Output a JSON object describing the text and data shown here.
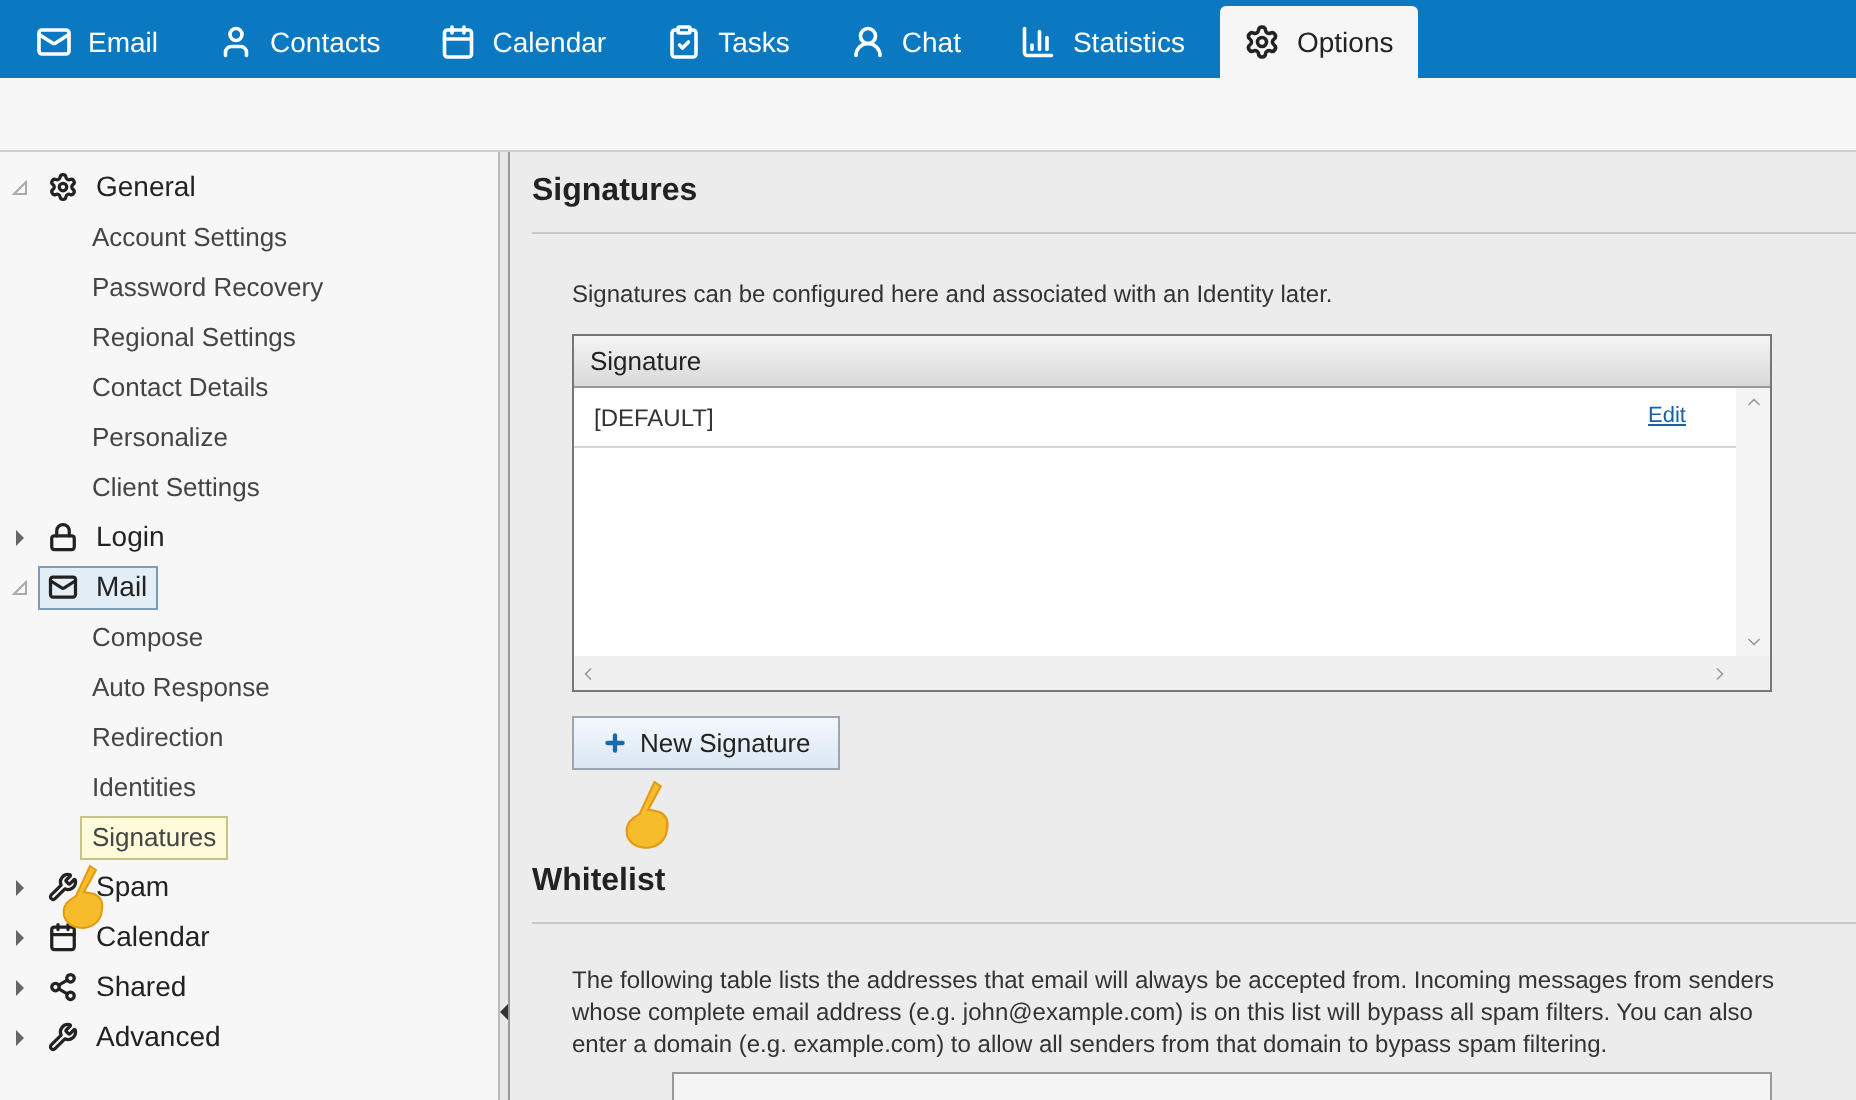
{
  "tabs": [
    {
      "label": "Email",
      "selected": false
    },
    {
      "label": "Contacts",
      "selected": false
    },
    {
      "label": "Calendar",
      "selected": false
    },
    {
      "label": "Tasks",
      "selected": false
    },
    {
      "label": "Chat",
      "selected": false
    },
    {
      "label": "Statistics",
      "selected": false
    },
    {
      "label": "Options",
      "selected": true
    }
  ],
  "sidebar": {
    "items": [
      {
        "label": "General",
        "expanded": true,
        "selected": false,
        "children": [
          {
            "label": "Account Settings",
            "selected": false
          },
          {
            "label": "Password Recovery",
            "selected": false
          },
          {
            "label": "Regional Settings",
            "selected": false
          },
          {
            "label": "Contact Details",
            "selected": false
          },
          {
            "label": "Personalize",
            "selected": false
          },
          {
            "label": "Client Settings",
            "selected": false
          }
        ]
      },
      {
        "label": "Login",
        "expanded": false,
        "selected": false
      },
      {
        "label": "Mail",
        "expanded": true,
        "selected": true,
        "children": [
          {
            "label": "Compose",
            "selected": false
          },
          {
            "label": "Auto Response",
            "selected": false
          },
          {
            "label": "Redirection",
            "selected": false
          },
          {
            "label": "Identities",
            "selected": false
          },
          {
            "label": "Signatures",
            "selected": true
          }
        ]
      },
      {
        "label": "Spam",
        "expanded": false,
        "selected": false
      },
      {
        "label": "Calendar",
        "expanded": false,
        "selected": false
      },
      {
        "label": "Shared",
        "expanded": false,
        "selected": false
      },
      {
        "label": "Advanced",
        "expanded": false,
        "selected": false
      }
    ]
  },
  "signatures": {
    "title": "Signatures",
    "description": "Signatures can be configured here and associated with an Identity later.",
    "table": {
      "columns": [
        "Signature"
      ],
      "rows": [
        {
          "name": "[DEFAULT]",
          "action": "Edit"
        }
      ]
    },
    "new_button": "New Signature"
  },
  "whitelist": {
    "title": "Whitelist",
    "description": "The following table lists the addresses that email will always be accepted from. Incoming messages from senders whose complete email address (e.g. john@example.com) is on this list will bypass all spam filters. You can also enter a domain (e.g. example.com) to allow all senders from that domain to bypass spam filtering."
  }
}
